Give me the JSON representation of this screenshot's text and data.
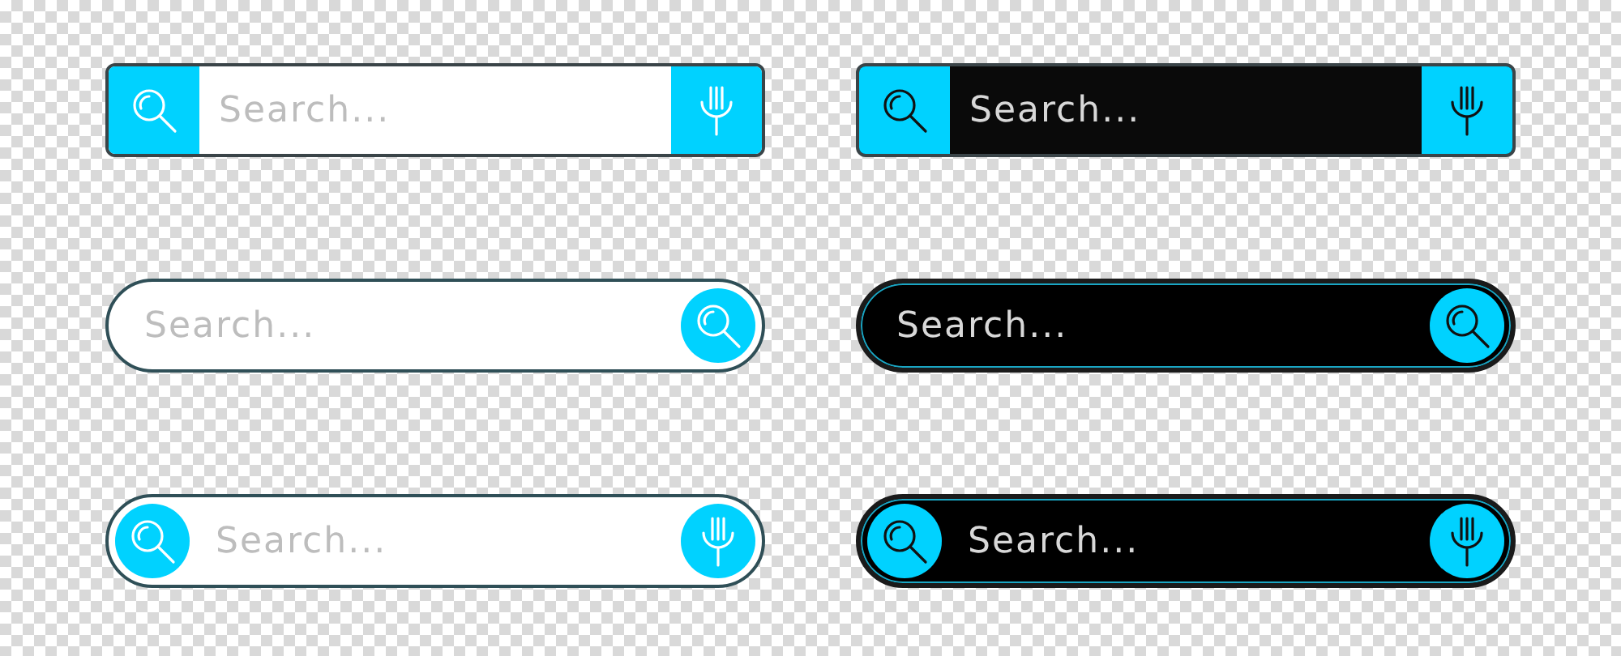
{
  "search_bars": [
    {
      "dark": false,
      "kind": "square",
      "search_at_end": false,
      "mic": true,
      "placeholder": "Search..."
    },
    {
      "dark": true,
      "kind": "square",
      "search_at_end": false,
      "mic": true,
      "placeholder": "Search..."
    },
    {
      "dark": false,
      "kind": "pill",
      "search_at_end": true,
      "mic": false,
      "placeholder": "Search..."
    },
    {
      "dark": true,
      "kind": "pill",
      "search_at_end": true,
      "mic": false,
      "placeholder": "Search..."
    },
    {
      "dark": false,
      "kind": "pill",
      "search_at_end": false,
      "mic": true,
      "placeholder": "Search..."
    },
    {
      "dark": true,
      "kind": "pill",
      "search_at_end": false,
      "mic": true,
      "placeholder": "Search..."
    }
  ]
}
